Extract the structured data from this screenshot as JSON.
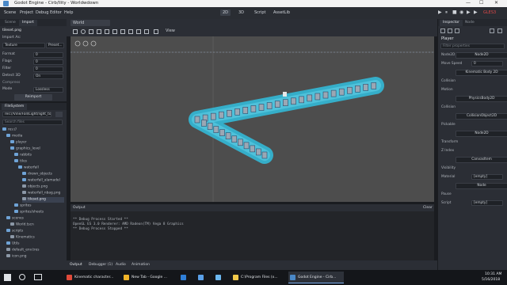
{
  "window": {
    "title": "Godot Engine - Cirb/llity - Worldwdown",
    "controls": [
      "—",
      "☐",
      "✕"
    ]
  },
  "menu": [
    "Scene",
    "Project",
    "Debug",
    "Editor",
    "Help"
  ],
  "modes": [
    {
      "label": "2D",
      "active": true
    },
    {
      "label": "3D",
      "active": false
    },
    {
      "label": "Script",
      "active": false
    },
    {
      "label": "AssetLib",
      "active": false
    }
  ],
  "play_buttons": [
    "▶",
    "⏸",
    "■",
    "◉",
    "▶",
    "▶"
  ],
  "gles": "GLES3",
  "left_top": {
    "tabs": [
      "Scene",
      "Import"
    ],
    "file": "tileset.png",
    "import_as_label": "Import As:",
    "import_as": "Texture",
    "preset": "Preset...",
    "rows": [
      {
        "label": "Format",
        "value": "0"
      },
      {
        "label": "Flags",
        "value": "0"
      },
      {
        "label": "Filter",
        "value": "0"
      },
      {
        "label": "Detect 3D",
        "value": "On"
      }
    ],
    "compress_label": "Compress",
    "mode_label": "Mode",
    "mode_value": "Lossless",
    "reimport": "Reimport"
  },
  "filesystem": {
    "title": "FileSystem",
    "path": "res://Vine/Fall/Light/light_to...",
    "search_placeholder": "Search files",
    "items": [
      {
        "label": "res://",
        "indent": 0,
        "folder": true
      },
      {
        "label": "media",
        "indent": 1,
        "folder": true
      },
      {
        "label": "player",
        "indent": 2,
        "folder": true
      },
      {
        "label": "graphics_level",
        "indent": 2,
        "folder": true
      },
      {
        "label": "rabbits",
        "indent": 3,
        "folder": true
      },
      {
        "label": "tiles",
        "indent": 3,
        "folder": true
      },
      {
        "label": "waterfall",
        "indent": 4,
        "folder": true
      },
      {
        "label": "drewn_objects",
        "indent": 5,
        "folder": true
      },
      {
        "label": "waterfall_alamadel",
        "indent": 5,
        "folder": true
      },
      {
        "label": "objects.png",
        "indent": 5,
        "folder": false
      },
      {
        "label": "waterfall_nbag.png",
        "indent": 5,
        "folder": false
      },
      {
        "label": "tileset.png",
        "indent": 5,
        "folder": false,
        "selected": true
      },
      {
        "label": "sprites",
        "indent": 3,
        "folder": true
      },
      {
        "label": "sprites/sheets",
        "indent": 3,
        "folder": true
      },
      {
        "label": "scenes",
        "indent": 1,
        "folder": true
      },
      {
        "label": "World.tscn",
        "indent": 2,
        "folder": false
      },
      {
        "label": "scripts",
        "indent": 1,
        "folder": true
      },
      {
        "label": "Kinematics",
        "indent": 2,
        "folder": false
      },
      {
        "label": "Utils",
        "indent": 1,
        "folder": true
      },
      {
        "label": "default_env.tres",
        "indent": 1,
        "folder": false
      },
      {
        "label": "icon.png",
        "indent": 1,
        "folder": false
      }
    ]
  },
  "viewport": {
    "tab": "World",
    "toolbar": "View"
  },
  "console": {
    "tab": "Output",
    "clear": "Clear",
    "lines": [
      "** Debug Process Started **",
      "OpenGL ES 3.0 Renderer: AMD Radeon(TM) Vega 8 Graphics",
      "** Debug Process Stopped **"
    ],
    "bottom_tabs": [
      "Output",
      "Debugger (1)",
      "Audio",
      "Animation"
    ]
  },
  "inspector": {
    "tabs": [
      "Inspector",
      "Node"
    ],
    "node": "Player",
    "filter": "Filter properties",
    "rows": [
      {
        "label": "Node2D",
        "kind": "button",
        "value": "Node2D"
      },
      {
        "label": "Move Speed",
        "kind": "field",
        "value": "0"
      },
      {
        "label": "",
        "kind": "button",
        "value": "Kinematic Body 2D"
      },
      {
        "label": "Collision",
        "kind": "head",
        "value": ""
      },
      {
        "label": "Motion",
        "kind": "head",
        "value": ""
      },
      {
        "label": "",
        "kind": "button",
        "value": "PhysicsBody2D"
      },
      {
        "label": "Collision",
        "kind": "head",
        "value": ""
      },
      {
        "label": "",
        "kind": "button",
        "value": "CollisionObject2D"
      },
      {
        "label": "Pickable",
        "kind": "head",
        "value": ""
      },
      {
        "label": "",
        "kind": "button",
        "value": "Node2D"
      },
      {
        "label": "Transform",
        "kind": "head",
        "value": ""
      },
      {
        "label": "Z Index",
        "kind": "head",
        "value": ""
      },
      {
        "label": "",
        "kind": "button",
        "value": "CanvasItem"
      },
      {
        "label": "Visibility",
        "kind": "head",
        "value": ""
      },
      {
        "label": "Material",
        "kind": "field",
        "value": "[empty]"
      },
      {
        "label": "",
        "kind": "button",
        "value": "Node"
      },
      {
        "label": "Pause",
        "kind": "head",
        "value": ""
      },
      {
        "label": "Script",
        "kind": "field",
        "value": "[empty]"
      }
    ]
  },
  "taskbar": {
    "items": [
      {
        "label": "Kinematic character...",
        "active": false
      },
      {
        "label": "New Tab - Google ...",
        "active": false
      },
      {
        "label": "",
        "active": false
      },
      {
        "label": "",
        "active": false
      },
      {
        "label": "",
        "active": false
      },
      {
        "label": "C:\\Program Files (x...",
        "active": false
      },
      {
        "label": "Godot Engine - Cirb...",
        "active": true
      }
    ],
    "time": "10:31 AM",
    "date": "5/16/2018"
  }
}
